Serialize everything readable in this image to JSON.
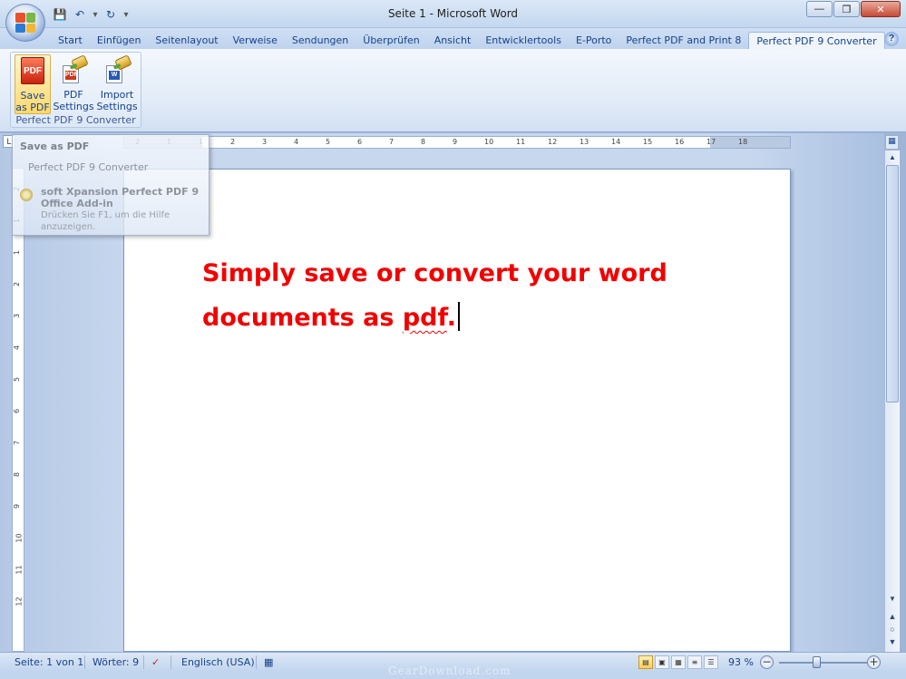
{
  "window": {
    "title": "Seite 1 - Microsoft Word"
  },
  "quick_access": {
    "save_icon": "save-icon",
    "undo_icon": "undo-icon",
    "redo_icon": "redo-icon"
  },
  "tabs": [
    {
      "label": "Start"
    },
    {
      "label": "Einfügen"
    },
    {
      "label": "Seitenlayout"
    },
    {
      "label": "Verweise"
    },
    {
      "label": "Sendungen"
    },
    {
      "label": "Überprüfen"
    },
    {
      "label": "Ansicht"
    },
    {
      "label": "Entwicklertools"
    },
    {
      "label": "E-Porto"
    },
    {
      "label": "Perfect PDF and Print 8"
    },
    {
      "label": "Perfect PDF 9 Converter"
    }
  ],
  "ribbon": {
    "group_label": "Perfect PDF 9 Converter",
    "buttons": [
      {
        "line1": "Save",
        "line2": "as PDF",
        "icon_text": "PDF"
      },
      {
        "line1": "PDF",
        "line2": "Settings",
        "icon_text": "PDF"
      },
      {
        "line1": "Import",
        "line2": "Settings",
        "icon_text": "W"
      }
    ]
  },
  "tooltip": {
    "title": "Save as PDF",
    "subtitle": "Perfect PDF 9 Converter",
    "addin_name": "soft Xpansion Perfect PDF 9 Office Add-in",
    "help": "Drücken Sie F1, um die Hilfe anzuzeigen."
  },
  "document": {
    "line1": "Simply save or convert your word",
    "line2_prefix": "documents as ",
    "line2_spell": "pdf",
    "line2_suffix": ".",
    "text_color": "#f20000"
  },
  "ruler": {
    "h_numbers": [
      "2",
      "1",
      "1",
      "2",
      "3",
      "4",
      "5",
      "6",
      "7",
      "8",
      "9",
      "10",
      "11",
      "12",
      "13",
      "14",
      "15",
      "16",
      "17",
      "18"
    ],
    "v_numbers": [
      "2",
      "1",
      "1",
      "2",
      "3",
      "4",
      "5",
      "6",
      "7",
      "8",
      "9",
      "10",
      "11",
      "12"
    ]
  },
  "statusbar": {
    "page": "Seite: 1 von 1",
    "words": "Wörter: 9",
    "language": "Englisch (USA)",
    "zoom": "93 %"
  },
  "watermark": "GearDownload.com"
}
